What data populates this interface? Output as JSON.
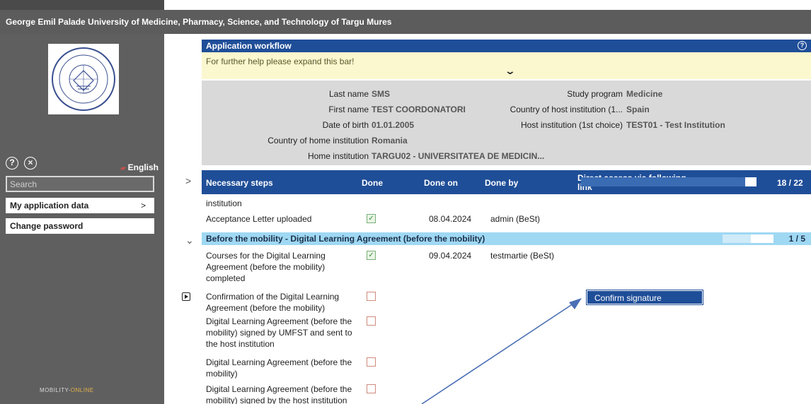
{
  "header": {
    "title": "George Emil Palade University of Medicine, Pharmacy, Science, and Technology of Targu Mures"
  },
  "sidebar": {
    "language": "English",
    "search": {
      "placeholder": "Search",
      "value": ""
    },
    "items": [
      {
        "label": "My application data",
        "chevron": ">"
      },
      {
        "label": "Change password"
      }
    ],
    "footer_logo": {
      "part1": "MOBILITY",
      "part2": "ONLINE"
    }
  },
  "workflow": {
    "title": "Application workflow",
    "help_text": "For further help please expand this bar!"
  },
  "info": {
    "last_name": {
      "label": "Last name",
      "value": "SMS"
    },
    "first_name": {
      "label": "First name",
      "value": "TEST COORDONATORI"
    },
    "dob": {
      "label": "Date of birth",
      "value": "01.01.2005"
    },
    "home_country": {
      "label": "Country of home institution",
      "value": "Romania"
    },
    "home_institution": {
      "label": "Home institution",
      "value": "TARGU02 - UNIVERSITATEA DE MEDICIN..."
    },
    "study_program": {
      "label": "Study program",
      "value": "Medicine"
    },
    "host_country": {
      "label": "Country of host institution (1...",
      "value": "Spain"
    },
    "host_institution": {
      "label": "Host institution (1st choice)",
      "value": "TEST01 - Test Institution"
    }
  },
  "steps": {
    "columns": {
      "steps": "Necessary steps",
      "done": "Done",
      "done_on": "Done on",
      "done_by": "Done by",
      "direct_access_1": "Direct access via following",
      "direct_access_2": "link"
    },
    "progress": {
      "count": "18 / 22",
      "fraction": 0.818
    },
    "rows": [
      {
        "text": "institution"
      },
      {
        "text": "Acceptance Letter uploaded",
        "done": true,
        "done_on": "08.04.2024",
        "done_by": "admin (BeSt)"
      }
    ]
  },
  "section": {
    "title": "Before the mobility - Digital Learning Agreement (before the mobility)",
    "progress": {
      "count": "1 / 5",
      "fraction": 0.2
    },
    "rows": [
      {
        "lines": [
          "Courses for the Digital Learning",
          "Agreement (before the mobility)",
          "completed"
        ],
        "done": true,
        "done_on": "09.04.2024",
        "done_by": "testmartie (BeSt)"
      },
      {
        "lines": [
          "Confirmation of the Digital Learning",
          "Agreement (before the mobility)"
        ],
        "done": false,
        "action": "Confirm signature"
      },
      {
        "lines": [
          "Digital Learning Agreement (before the",
          "mobility) signed by UMFST and sent to",
          "the host institution"
        ],
        "done": false
      },
      {
        "lines": [
          "Digital Learning Agreement (before the",
          "mobility)"
        ],
        "done": false
      },
      {
        "lines": [
          "Digital Learning Agreement (before the",
          "mobility) signed by the host institution"
        ],
        "done": false
      }
    ]
  },
  "colors": {
    "header": "#5c5c5c",
    "sidebar": "#5f5f5f",
    "primary": "#1f4e98",
    "section": "#9fd8f3",
    "help": "#fbf7cf",
    "arrow": "#4a6fb5"
  }
}
